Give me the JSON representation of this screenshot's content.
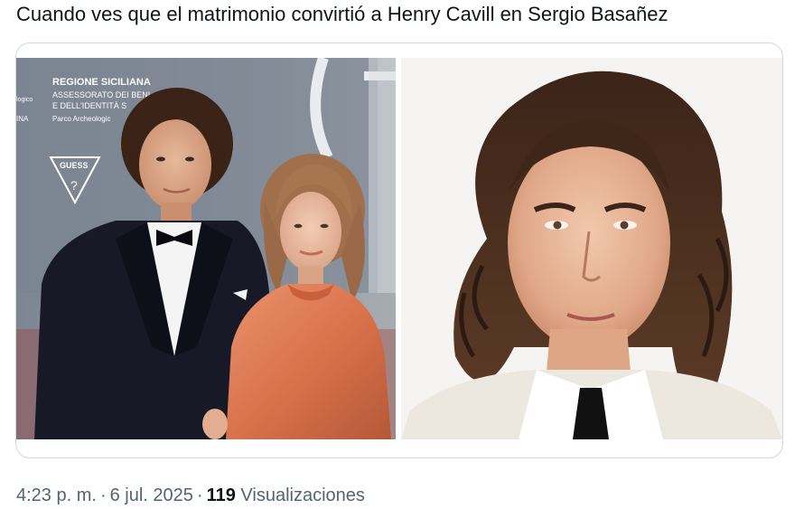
{
  "tweet": {
    "text": "Cuando ves que el matrimonio convirtió a Henry Cavill en Sergio Basañez"
  },
  "media": {
    "left_photo": {
      "backdrop_text": {
        "line1": "REGIONE SICILIANA",
        "line2": "ASSESSORATO DEI BENI",
        "line3": "E DELL'IDENTITÀ S",
        "line4": "Parco Archeologic",
        "side1": "logico",
        "side2": "INA",
        "brand": "GUESS"
      }
    }
  },
  "meta": {
    "time": "4:23 p. m.",
    "date": "6 jul. 2025",
    "separator": "·",
    "views_count": "119",
    "views_label": "Visualizaciones"
  }
}
